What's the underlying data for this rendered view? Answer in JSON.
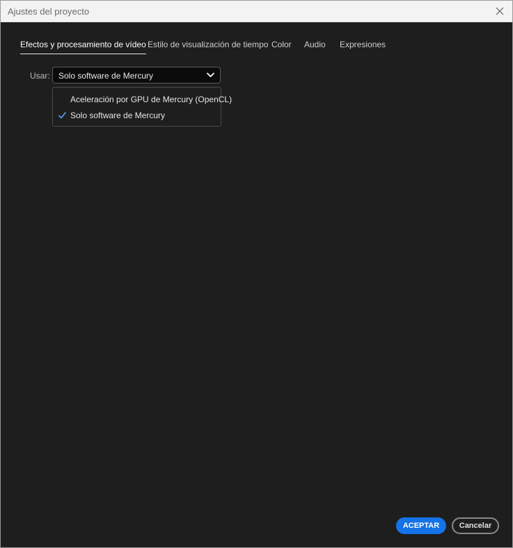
{
  "window": {
    "title": "Ajustes del proyecto"
  },
  "tabs": [
    {
      "label": "Efectos y procesamiento de vídeo",
      "active": true
    },
    {
      "label": "Estilo de visualización de tiempo",
      "active": false
    },
    {
      "label": "Color",
      "active": false
    },
    {
      "label": "Audio",
      "active": false
    },
    {
      "label": "Expresiones",
      "active": false
    }
  ],
  "renderer": {
    "label": "Usar:",
    "selected": "Solo software de Mercury",
    "options": [
      {
        "label": "Aceleración por GPU de Mercury (OpenCL)",
        "checked": false
      },
      {
        "label": "Solo software de Mercury",
        "checked": true
      }
    ]
  },
  "footer": {
    "accept_label": "ACEPTAR",
    "cancel_label": "Cancelar"
  },
  "colors": {
    "accent": "#1473e6",
    "background": "#1e1e1e",
    "check": "#5aa0ff"
  },
  "icons": {
    "close": "close-icon",
    "chevron": "chevron-down-icon",
    "check": "checkmark-icon"
  }
}
